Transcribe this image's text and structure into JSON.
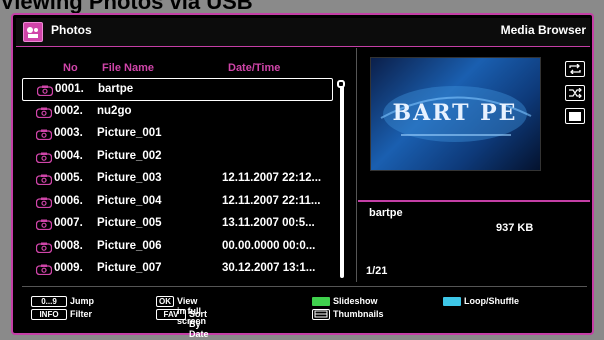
{
  "page_heading": "Viewing Photos via USB",
  "header": {
    "title": "Photos",
    "right_label": "Media Browser"
  },
  "columns": {
    "no": "No",
    "file_name": "File Name",
    "date_time": "Date/Time"
  },
  "files": [
    {
      "no": "0001.",
      "name": "bartpe",
      "date": "",
      "selected": true
    },
    {
      "no": "0002.",
      "name": "nu2go",
      "date": ""
    },
    {
      "no": "0003.",
      "name": "Picture_001",
      "date": ""
    },
    {
      "no": "0004.",
      "name": "Picture_002",
      "date": ""
    },
    {
      "no": "0005.",
      "name": "Picture_003",
      "date": "12.11.2007 22:12..."
    },
    {
      "no": "0006.",
      "name": "Picture_004",
      "date": "12.11.2007 22:11..."
    },
    {
      "no": "0007.",
      "name": "Picture_005",
      "date": "13.11.2007 00:5..."
    },
    {
      "no": "0008.",
      "name": "Picture_006",
      "date": "00.00.0000 00:0..."
    },
    {
      "no": "0009.",
      "name": "Picture_007",
      "date": "30.12.2007 13:1..."
    }
  ],
  "preview": {
    "image_text": "BART PE"
  },
  "info": {
    "name": "bartpe",
    "size": "937 KB",
    "count": "1/21"
  },
  "footer": {
    "key_0_9": "0...9",
    "jump": "Jump",
    "key_info": "INFO",
    "filter": "Filter",
    "key_ok": "OK",
    "view_full": "View in full screen",
    "key_fav": "FAV",
    "sort_date": "Sort By Date",
    "slideshow": "Slideshow",
    "thumbnails": "Thumbnails",
    "loop_shuffle": "Loop/Shuffle"
  },
  "colors": {
    "accent": "#c43fa6",
    "green_key": "#3fd14d",
    "blue_key": "#3ec7e8"
  }
}
